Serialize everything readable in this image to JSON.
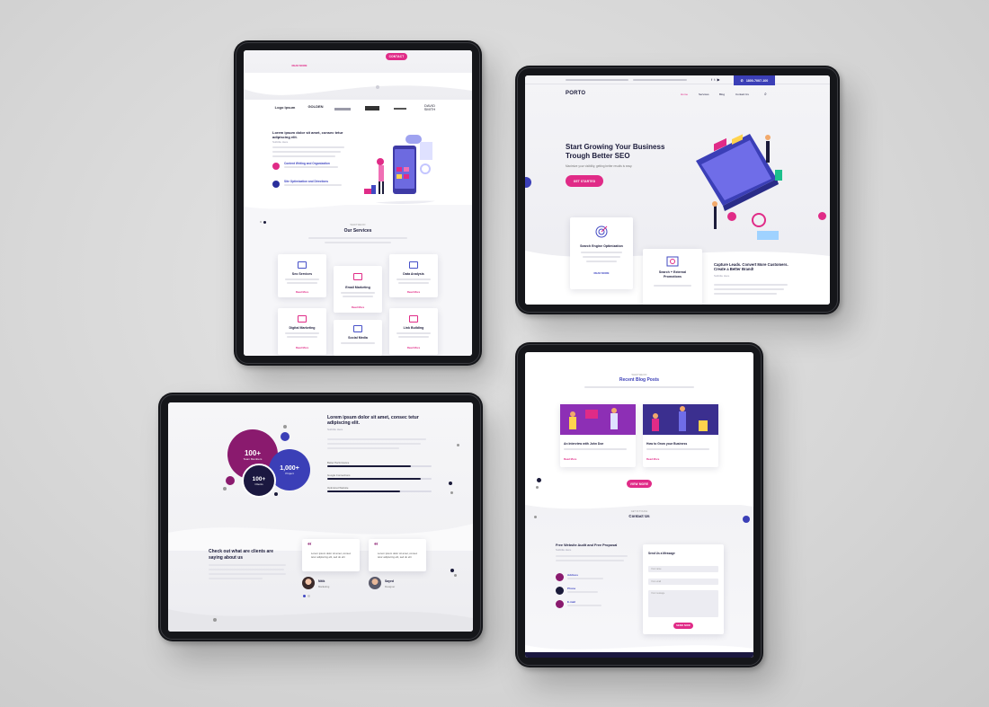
{
  "colors": {
    "pink": "#e02b87",
    "navy": "#1b1b3a",
    "indigo": "#4148c2",
    "purple": "#8a1a6e"
  },
  "t1": {
    "top_btn": "CONTACT",
    "read_more": "READ MORE",
    "logos": [
      "Logo Ipsum",
      "GOLDEN",
      "",
      "",
      "",
      "DAVID SMITH"
    ],
    "intro_title": "Lorem ipsum dolor sit amet, consec tetur adipiscing elit.",
    "intro_sub": "Subtitle Here",
    "feature1": "Content Writing and Organization",
    "feature2": "Site Optimization and Directions",
    "services_kicker": "WHAT WE DO",
    "services_title": "Our Services",
    "services": [
      {
        "title": "Seo Services",
        "more": "Read More"
      },
      {
        "title": "Email Marketing",
        "more": "Read More"
      },
      {
        "title": "Data Analysis",
        "more": "Read More"
      },
      {
        "title": "Digital Marketing",
        "more": "Read More"
      },
      {
        "title": "Social Media",
        "more": "Read More"
      },
      {
        "title": "Link Building",
        "more": "Read More"
      }
    ]
  },
  "t2": {
    "phone": "1800-7007-100",
    "logo": "PORTO",
    "nav": [
      "Home",
      "Services",
      "Blog",
      "Contact Us"
    ],
    "hero_title_1": "Start Growing Your Business",
    "hero_title_2": "Trough Better SEO",
    "hero_sub": "Maximize your visibility, getting better results is easy.",
    "hero_btn": "GET STARTED",
    "card1_title": "Search Engine Optimization",
    "card1_more": "READ MORE",
    "card2_title": "Search + External Promotions",
    "capture_title": "Capture Leads. Convert More Customers. Create a Better Brand!",
    "capture_sub": "Subtitle Here"
  },
  "t3": {
    "circle1_num": "100+",
    "circle1_label": "Team Members",
    "circle2_num": "1,000+",
    "circle2_label": "Project",
    "circle3_num": "100+",
    "circle3_label": "Clients",
    "title": "Lorem ipsum dolor sit amet, consec tetur adipiscing elit.",
    "sub": "Subtitle Here",
    "bars": [
      {
        "label": "Better Performance",
        "pct": 80
      },
      {
        "label": "Google Connections",
        "pct": 90
      },
      {
        "label": "Optimized Website",
        "pct": 70
      }
    ],
    "clients_title_1": "Check out what are clients are",
    "clients_title_2": "saying about us",
    "quote": "Lorem ipsum dolor sit amet, consec tetur adipiscing elit, sed do elit",
    "person1_name": "Nitik",
    "person1_role": "Marketing",
    "person2_name": "Sayed",
    "person2_role": "Designer"
  },
  "t4": {
    "blog_kicker": "WHAT WE DO",
    "blog_title": "Recent Blog Posts",
    "post1": "An Interview with John Doe",
    "post2": "How to Grow your Business",
    "read_more": "Read More",
    "view_more": "VIEW MORE",
    "contact_kicker": "GET IN TOUCH",
    "contact_title": "Contact Us",
    "audit_title": "Free Website Audit and Free Proposal",
    "audit_sub": "Subtitle Here",
    "info": [
      {
        "label": "Address"
      },
      {
        "label": "Phone"
      },
      {
        "label": "E-mail"
      }
    ],
    "form_title": "Send Us a Message",
    "field_name": "Your name",
    "field_email": "Your email",
    "field_msg": "Your message",
    "send_btn": "SEND NOW"
  }
}
